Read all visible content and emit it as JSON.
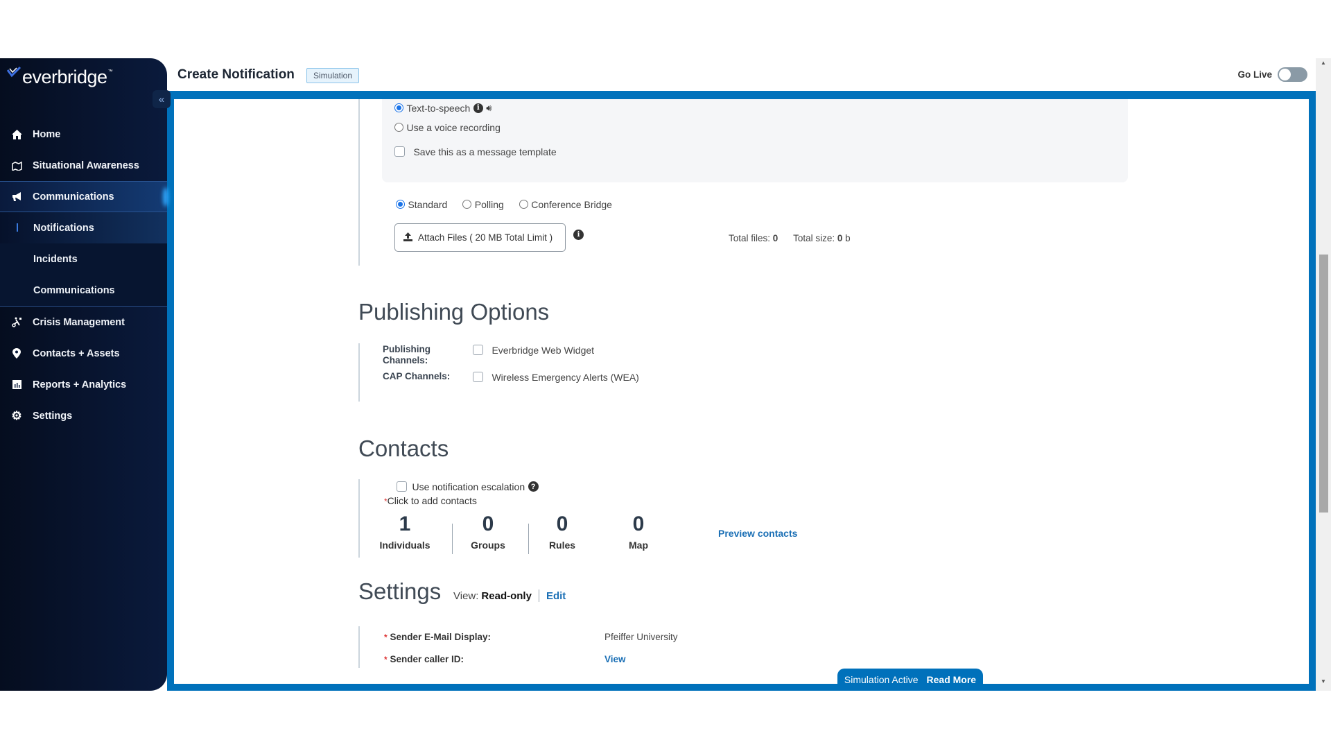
{
  "brand": {
    "name": "everbridge",
    "accent": "#0071bb"
  },
  "sidebar": {
    "collapse_label": "«",
    "items": [
      {
        "label": "Home",
        "icon": "home-icon"
      },
      {
        "label": "Situational Awareness",
        "icon": "map-icon"
      },
      {
        "label": "Communications",
        "icon": "megaphone-icon",
        "active": true
      },
      {
        "label": "Crisis Management",
        "icon": "crisis-icon"
      },
      {
        "label": "Contacts + Assets",
        "icon": "location-pin-icon"
      },
      {
        "label": "Reports + Analytics",
        "icon": "bar-chart-icon"
      },
      {
        "label": "Settings",
        "icon": "gear-icon"
      }
    ],
    "subitems": [
      {
        "label": "Notifications",
        "current": true
      },
      {
        "label": "Incidents"
      },
      {
        "label": "Communications"
      }
    ]
  },
  "header": {
    "title": "Create Notification",
    "badge": "Simulation",
    "go_live_label": "Go Live",
    "go_live_on": false
  },
  "voice": {
    "tts_label": "Text-to-speech",
    "recording_label": "Use a voice recording",
    "template_label": "Save this as a message template"
  },
  "message_type": {
    "options": [
      "Standard",
      "Polling",
      "Conference Bridge"
    ],
    "selected": "Standard"
  },
  "attach": {
    "button_label": "Attach Files ( 20 MB Total Limit )",
    "total_files_label": "Total files:",
    "total_files": "0",
    "total_size_label": "Total size:",
    "total_size": "0",
    "total_size_unit": "b"
  },
  "publishing": {
    "title": "Publishing Options",
    "channels_label": "Publishing Channels:",
    "channels_option": "Everbridge Web Widget",
    "cap_label": "CAP Channels:",
    "cap_option": "Wireless Emergency Alerts (WEA)"
  },
  "contacts": {
    "title": "Contacts",
    "escalation_label": "Use notification escalation",
    "add_label": "Click to add contacts",
    "counts": [
      {
        "value": "1",
        "label": "Individuals"
      },
      {
        "value": "0",
        "label": "Groups"
      },
      {
        "value": "0",
        "label": "Rules"
      },
      {
        "value": "0",
        "label": "Map"
      }
    ],
    "preview_label": "Preview contacts"
  },
  "settings": {
    "title": "Settings",
    "view_label": "View:",
    "view_mode": "Read-only",
    "edit_label": "Edit",
    "rows": [
      {
        "label": "Sender E-Mail Display:",
        "value": "Pfeiffer University"
      },
      {
        "label": "Sender caller ID:",
        "value": "View",
        "is_link": true
      }
    ]
  },
  "banner": {
    "text": "Simulation Active",
    "link": "Read More"
  }
}
